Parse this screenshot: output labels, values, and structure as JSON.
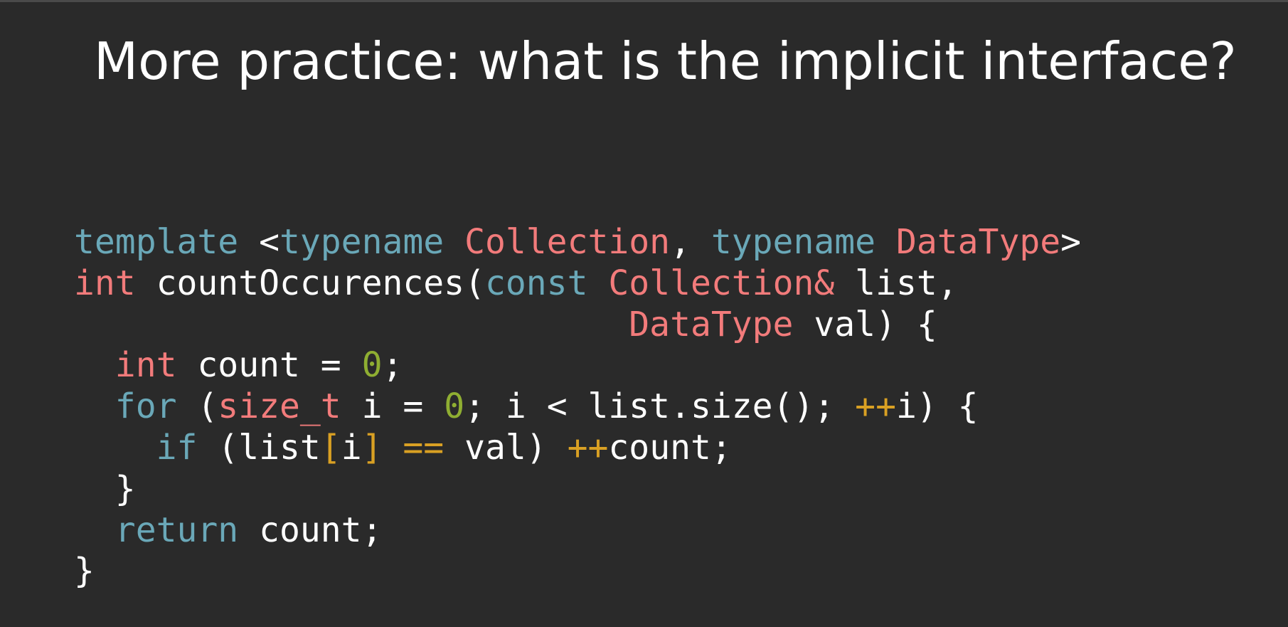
{
  "slide": {
    "title": "More practice: what is the implicit interface?"
  },
  "colors": {
    "background": "#2a2a2a",
    "keyword": "#6aa8b8",
    "type": "#f27b7b",
    "number": "#8fae32",
    "operator": "#d9a023",
    "text": "#ffffff"
  },
  "code": {
    "language": "cpp",
    "lines": [
      [
        {
          "t": "kw",
          "s": "template"
        },
        {
          "t": "plain",
          "s": " <"
        },
        {
          "t": "kw",
          "s": "typename"
        },
        {
          "t": "plain",
          "s": " "
        },
        {
          "t": "type",
          "s": "Collection"
        },
        {
          "t": "plain",
          "s": ", "
        },
        {
          "t": "kw",
          "s": "typename"
        },
        {
          "t": "plain",
          "s": " "
        },
        {
          "t": "type",
          "s": "DataType"
        },
        {
          "t": "plain",
          "s": ">"
        }
      ],
      [
        {
          "t": "type",
          "s": "int"
        },
        {
          "t": "plain",
          "s": " countOccurences("
        },
        {
          "t": "kw",
          "s": "const"
        },
        {
          "t": "plain",
          "s": " "
        },
        {
          "t": "type",
          "s": "Collection&"
        },
        {
          "t": "plain",
          "s": " list,"
        }
      ],
      [
        {
          "t": "plain",
          "s": "                           "
        },
        {
          "t": "type",
          "s": "DataType"
        },
        {
          "t": "plain",
          "s": " val) {"
        }
      ],
      [
        {
          "t": "plain",
          "s": "  "
        },
        {
          "t": "type",
          "s": "int"
        },
        {
          "t": "plain",
          "s": " count = "
        },
        {
          "t": "num",
          "s": "0"
        },
        {
          "t": "plain",
          "s": ";"
        }
      ],
      [
        {
          "t": "plain",
          "s": "  "
        },
        {
          "t": "kw",
          "s": "for"
        },
        {
          "t": "plain",
          "s": " ("
        },
        {
          "t": "type",
          "s": "size_t"
        },
        {
          "t": "plain",
          "s": " i = "
        },
        {
          "t": "num",
          "s": "0"
        },
        {
          "t": "plain",
          "s": "; i < list.size(); "
        },
        {
          "t": "op",
          "s": "++"
        },
        {
          "t": "plain",
          "s": "i) {"
        }
      ],
      [
        {
          "t": "plain",
          "s": "    "
        },
        {
          "t": "kw",
          "s": "if"
        },
        {
          "t": "plain",
          "s": " (list"
        },
        {
          "t": "op",
          "s": "["
        },
        {
          "t": "plain",
          "s": "i"
        },
        {
          "t": "op",
          "s": "]"
        },
        {
          "t": "plain",
          "s": " "
        },
        {
          "t": "op",
          "s": "=="
        },
        {
          "t": "plain",
          "s": " val) "
        },
        {
          "t": "op",
          "s": "++"
        },
        {
          "t": "plain",
          "s": "count;"
        }
      ],
      [
        {
          "t": "plain",
          "s": "  }"
        }
      ],
      [
        {
          "t": "plain",
          "s": "  "
        },
        {
          "t": "kw",
          "s": "return"
        },
        {
          "t": "plain",
          "s": " count;"
        }
      ],
      [
        {
          "t": "plain",
          "s": "}"
        }
      ]
    ]
  }
}
